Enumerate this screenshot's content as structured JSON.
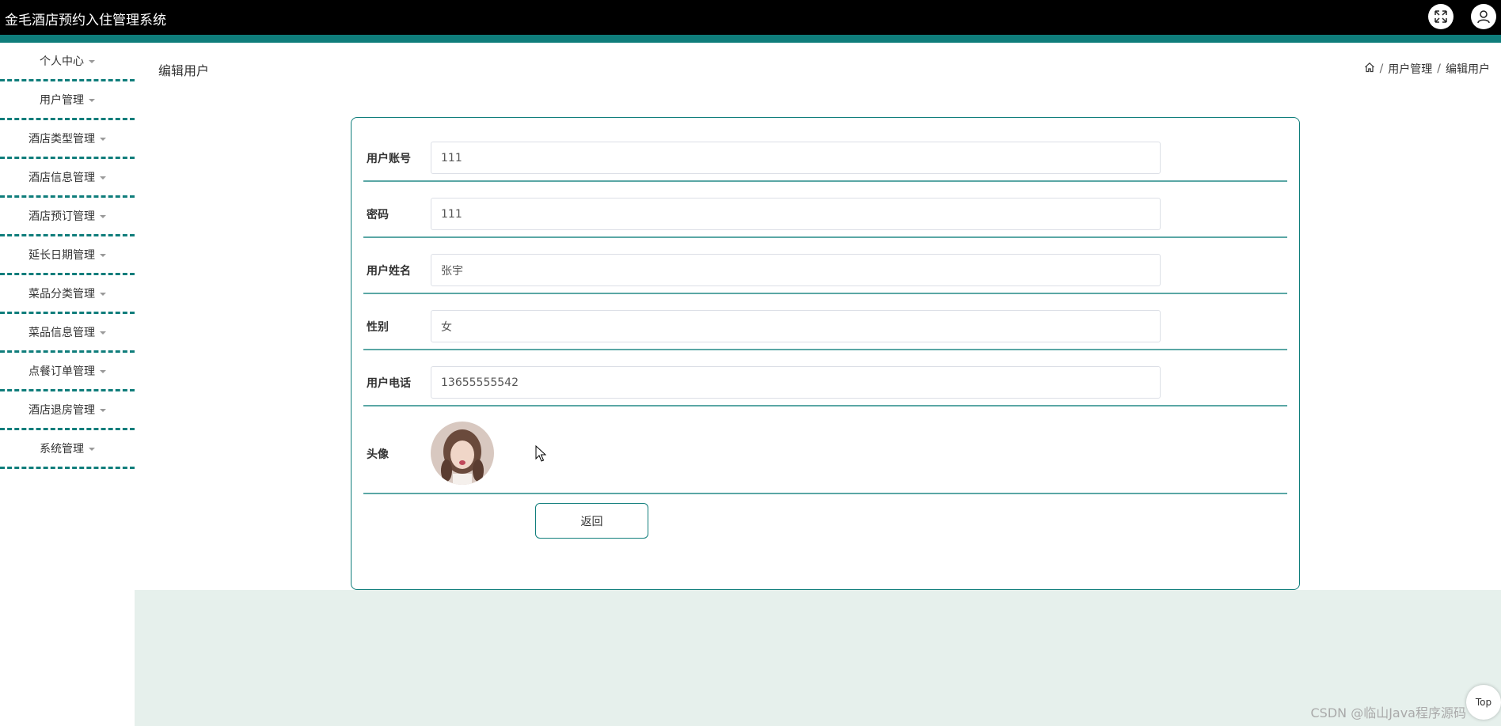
{
  "app": {
    "title": "金毛酒店预约入住管理系统"
  },
  "sidebar": {
    "items": [
      {
        "label": "个人中心"
      },
      {
        "label": "用户管理"
      },
      {
        "label": "酒店类型管理"
      },
      {
        "label": "酒店信息管理"
      },
      {
        "label": "酒店预订管理"
      },
      {
        "label": "延长日期管理"
      },
      {
        "label": "菜品分类管理"
      },
      {
        "label": "菜品信息管理"
      },
      {
        "label": "点餐订单管理"
      },
      {
        "label": "酒店退房管理"
      },
      {
        "label": "系统管理"
      }
    ]
  },
  "page": {
    "title": "编辑用户"
  },
  "breadcrumb": {
    "level1": "用户管理",
    "level2": "编辑用户"
  },
  "form": {
    "account": {
      "label": "用户账号",
      "value": "111"
    },
    "password": {
      "label": "密码",
      "value": "111"
    },
    "name": {
      "label": "用户姓名",
      "value": "张宇"
    },
    "gender": {
      "label": "性别",
      "value": "女"
    },
    "phone": {
      "label": "用户电话",
      "value": "13655555542"
    },
    "avatar": {
      "label": "头像"
    },
    "back_label": "返回"
  },
  "footer": {
    "watermark": "CSDN @临山Java程序源码",
    "top_label": "Top"
  },
  "colors": {
    "accent": "#0f7d7b",
    "header": "#000000",
    "bottom_bg": "#e6f0ec"
  }
}
